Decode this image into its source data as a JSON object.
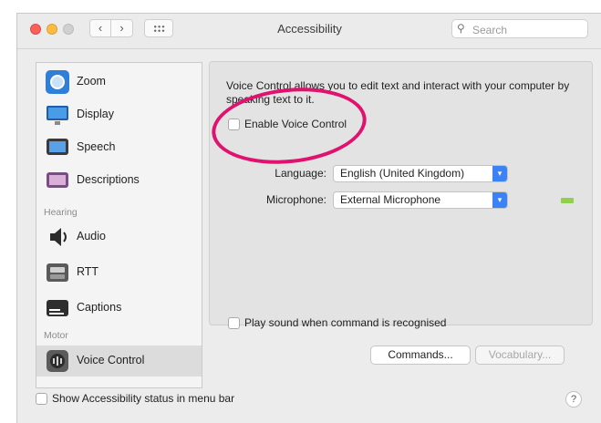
{
  "window": {
    "title": "Accessibility",
    "search_placeholder": "Search"
  },
  "sidebar": {
    "items": [
      {
        "label": "Zoom",
        "icon": "zoom-icon"
      },
      {
        "label": "Display",
        "icon": "display-icon"
      },
      {
        "label": "Speech",
        "icon": "speech-icon"
      },
      {
        "label": "Descriptions",
        "icon": "descriptions-icon"
      },
      {
        "label": "Audio",
        "icon": "audio-icon"
      },
      {
        "label": "RTT",
        "icon": "rtt-icon"
      },
      {
        "label": "Captions",
        "icon": "captions-icon"
      },
      {
        "label": "Voice Control",
        "icon": "voice-control-icon"
      }
    ],
    "sections": {
      "hearing": "Hearing",
      "motor": "Motor"
    }
  },
  "main": {
    "description": "Voice Control allows you to edit text and interact with your computer by speaking text to it.",
    "enable_label": "Enable Voice Control",
    "language_label": "Language:",
    "language_value": "English (United Kingdom)",
    "microphone_label": "Microphone:",
    "microphone_value": "External Microphone",
    "play_sound_label": "Play sound when command is recognised",
    "commands_button": "Commands...",
    "vocabulary_button": "Vocabulary..."
  },
  "footer": {
    "status_label": "Show Accessibility status in menu bar",
    "help_label": "?"
  },
  "colors": {
    "annotation": "#e0126f",
    "accent": "#3b82f6"
  }
}
